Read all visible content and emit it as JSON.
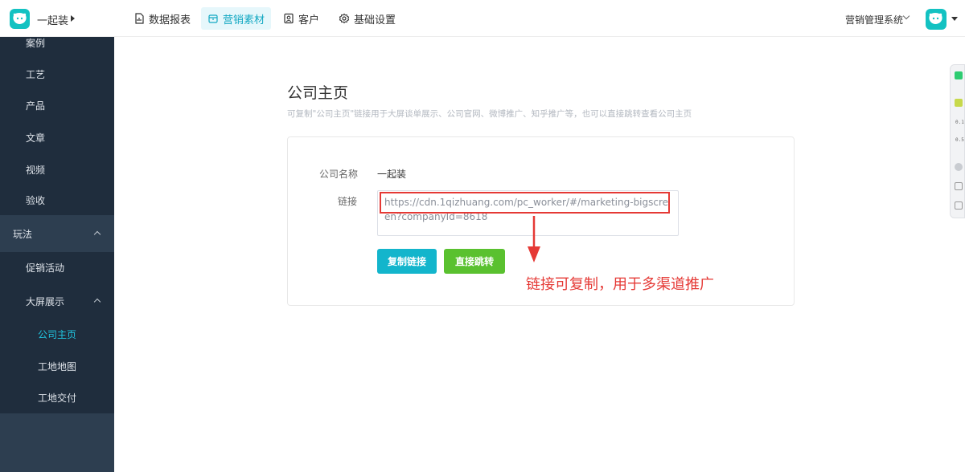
{
  "header": {
    "company_name": "一起装",
    "nav": [
      {
        "label": "数据报表",
        "icon": "file-chart-icon"
      },
      {
        "label": "营销素材",
        "icon": "marketing-box-icon"
      },
      {
        "label": "客户",
        "icon": "customer-card-icon"
      },
      {
        "label": "基础设置",
        "icon": "gear-icon"
      }
    ],
    "system_switch": "营销管理系统"
  },
  "sidebar": {
    "items": [
      {
        "label": "案例"
      },
      {
        "label": "工艺"
      },
      {
        "label": "产品"
      },
      {
        "label": "文章"
      },
      {
        "label": "视频"
      },
      {
        "label": "验收"
      },
      {
        "label": "玩法"
      },
      {
        "label": "促销活动"
      },
      {
        "label": "大屏展示"
      },
      {
        "label": "公司主页"
      },
      {
        "label": "工地地图"
      },
      {
        "label": "工地交付"
      }
    ]
  },
  "main": {
    "title": "公司主页",
    "subtitle": "可复制\"公司主页\"链接用于大屏谈单展示、公司官网、微博推广、知乎推广等，也可以直接跳转查看公司主页",
    "company_label": "公司名称",
    "company_value": "一起装",
    "link_label": "链接",
    "link_value": "https://cdn.1qizhuang.com/pc_worker/#/marketing-bigscreen?companyId=8618",
    "copy_button": "复制链接",
    "jump_button": "直接跳转",
    "annotation": "链接可复制，用于多渠道推广"
  },
  "widget": {
    "line1": "0.1",
    "line2": "0.5"
  },
  "colors": {
    "accent": "#13b5cc",
    "green": "#5ac12f",
    "sidebar_bg": "#2d3e50",
    "annotation_red": "#e53935"
  }
}
